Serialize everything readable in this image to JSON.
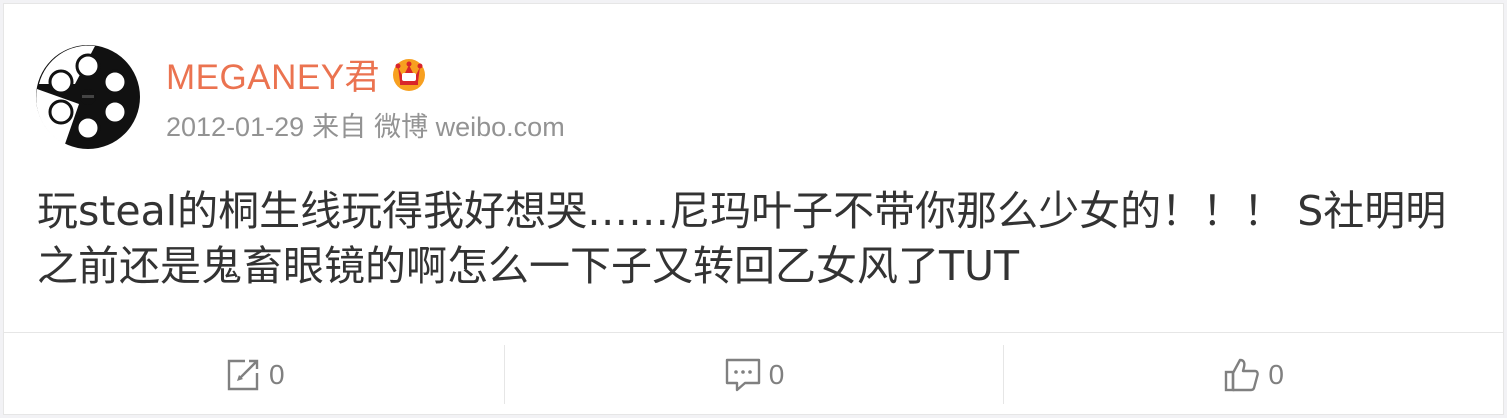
{
  "post": {
    "author": "MEGANEY君",
    "badge_icon": "crown-icon",
    "date": "2012-01-29",
    "source_prefix": "来自",
    "source": "微博 weibo.com",
    "text_line1": "玩steal的桐生线玩得我好想哭……尼玛叶子不带你那么少女的！！！ S社明明",
    "text_line2": "之前还是鬼畜眼镜的啊怎么一下子又转回乙女风了TUT"
  },
  "actions": {
    "repost_count": "0",
    "comment_count": "0",
    "like_count": "0"
  },
  "colors": {
    "author": "#eb7350",
    "meta": "#939393",
    "text": "#333333",
    "icon": "#808080"
  }
}
